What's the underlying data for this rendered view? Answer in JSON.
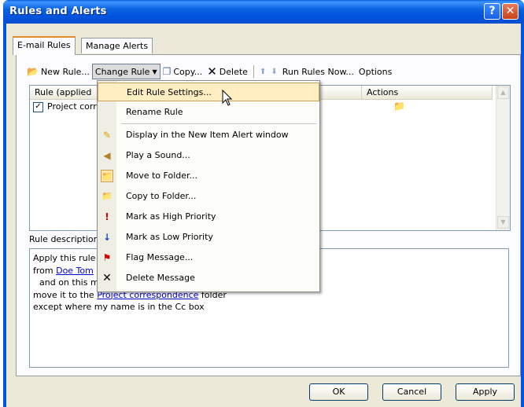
{
  "window": {
    "title": "Rules and Alerts"
  },
  "tabs": [
    {
      "label": "E-mail Rules",
      "active": true
    },
    {
      "label": "Manage Alerts",
      "active": false
    }
  ],
  "toolbar": {
    "new_rule": "New Rule...",
    "change_rule": "Change Rule",
    "copy": "Copy...",
    "delete": "Delete",
    "run_rules": "Run Rules Now...",
    "options": "Options"
  },
  "rules_table": {
    "columns": [
      "Rule (applied",
      "Actions"
    ],
    "rows": [
      {
        "name": "Project corre",
        "checked": true
      }
    ]
  },
  "change_rule_menu": [
    {
      "label": "Edit Rule Settings...",
      "icon": "none",
      "highlighted": true
    },
    {
      "label": "Rename Rule",
      "icon": "none"
    },
    {
      "label": "Display in the New Item Alert window",
      "icon": "alert-window-icon"
    },
    {
      "label": "Play a Sound...",
      "icon": "speaker-icon"
    },
    {
      "label": "Move to Folder...",
      "icon": "move-folder-icon"
    },
    {
      "label": "Copy to Folder...",
      "icon": "copy-folder-icon"
    },
    {
      "label": "Mark as High Priority",
      "icon": "high-priority-icon"
    },
    {
      "label": "Mark as Low Priority",
      "icon": "low-priority-icon"
    },
    {
      "label": "Flag Message...",
      "icon": "flag-icon"
    },
    {
      "label": "Delete Message",
      "icon": "delete-x-icon"
    }
  ],
  "description": {
    "label": "Rule description (",
    "lines": {
      "l1": "Apply this rule a",
      "l2_prefix": "from ",
      "l2_link": "Doe Tom",
      "l3": "and on this ma",
      "l4_prefix": "move it to the ",
      "l4_link": "Project correspondence",
      "l4_suffix": " folder",
      "l5": "except where my name is in the Cc box"
    }
  },
  "buttons": {
    "ok": "OK",
    "cancel": "Cancel",
    "apply": "Apply"
  }
}
